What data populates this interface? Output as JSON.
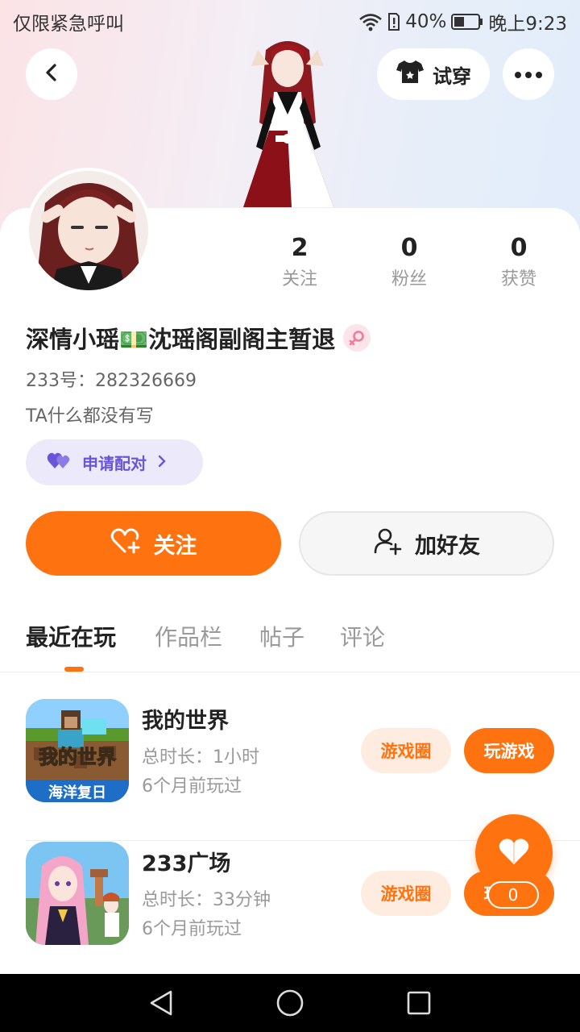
{
  "status_bar": {
    "carrier": "仅限紧急呼叫",
    "battery": "40%",
    "time": "晚上9:23"
  },
  "header": {
    "tryon_label": "试穿"
  },
  "stats": [
    {
      "value": "2",
      "label": "关注"
    },
    {
      "value": "0",
      "label": "粉丝"
    },
    {
      "value": "0",
      "label": "获赞"
    }
  ],
  "profile": {
    "name": "深情小瑶💵沈瑶阁副阁主暂退",
    "uid": "233号：282326669",
    "bio": "TA什么都没有写",
    "gender": "female",
    "match_label": "申请配对"
  },
  "actions": {
    "follow_label": "关注",
    "add_friend_label": "加好友"
  },
  "tabs": [
    {
      "label": "最近在玩",
      "active": true
    },
    {
      "label": "作品栏",
      "active": false
    },
    {
      "label": "帖子",
      "active": false
    },
    {
      "label": "评论",
      "active": false
    }
  ],
  "games": [
    {
      "name": "我的世界",
      "duration": "总时长：1小时",
      "last_played": "6个月前玩过",
      "icon_text_top": "我的世界",
      "icon_text_bottom": "海洋复日",
      "circle_label": "游戏圈",
      "play_label": "玩游戏"
    },
    {
      "name": "233广场",
      "duration": "总时长：33分钟",
      "last_played": "6个月前玩过",
      "circle_label": "游戏圈",
      "play_label": "玩游戏"
    }
  ],
  "floating_like": {
    "count": "0"
  },
  "colors": {
    "accent": "#ff7210",
    "match_purple": "#6a55d9",
    "gender_pink": "#f27a9a"
  }
}
